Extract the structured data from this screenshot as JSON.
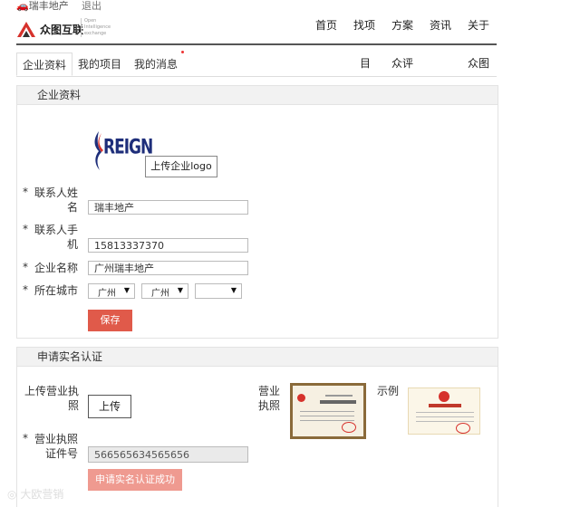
{
  "topbar": {
    "user": "🚗瑞丰地产",
    "logout": "退出"
  },
  "logo": {
    "name_cn": "众图互联",
    "name_en": "Open Intelligence exchange"
  },
  "nav": [
    "首页",
    "找项",
    "方案",
    "资讯",
    "关于"
  ],
  "tabs": [
    "企业资料",
    "我的项目",
    "我的消息"
  ],
  "subnav": [
    "目",
    "众评",
    "众图"
  ],
  "company_section": {
    "title": "企业资料",
    "logo_text": "REIGN",
    "upload_logo": "上传企业logo",
    "contact_name": {
      "label1": "联系人姓",
      "label2": "名",
      "value": "瑞丰地产"
    },
    "contact_phone": {
      "label1": "联系人手",
      "label2": "机",
      "value": "15813337370"
    },
    "company_name": {
      "label": "企业名称",
      "value": "广州瑞丰地产"
    },
    "city": {
      "label": "所在城市",
      "values": [
        "广州",
        "广州",
        ""
      ]
    },
    "save": "保存"
  },
  "verify_section": {
    "title": "申请实名认证",
    "upload_label1": "上传营业执",
    "upload_label2": "照",
    "upload_button": "上传",
    "license_label1": "营业",
    "license_label2": "执照",
    "example_label": "示例",
    "cert_no_label1": "营业执照",
    "cert_no_label2": "证件号",
    "cert_no_value": "566565634565656",
    "submit": "申请实名认证成功"
  },
  "watermark": "大欧营销",
  "colors": {
    "accent": "#e05a4a",
    "accent_light": "#ef9a90"
  }
}
